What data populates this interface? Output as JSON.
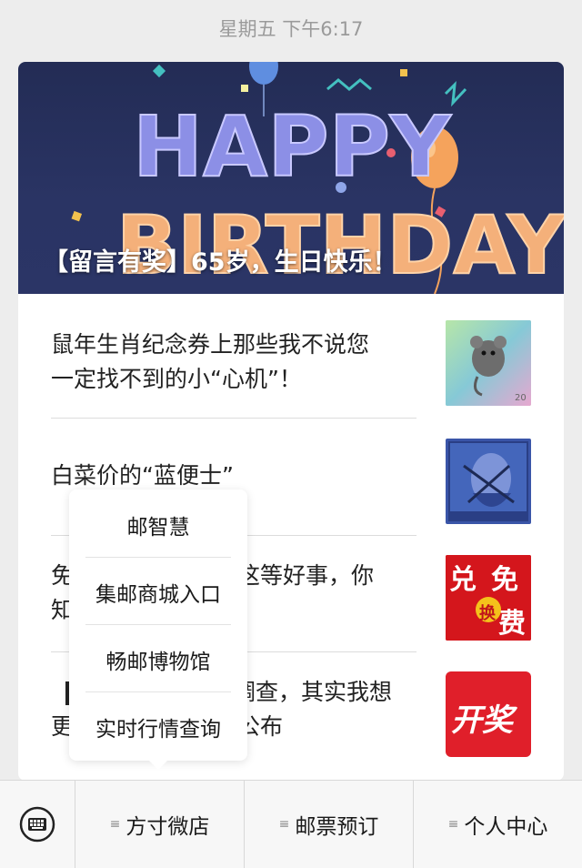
{
  "header": {
    "timestamp": "星期五 下午6:17"
  },
  "banner": {
    "image_text": "HAPPY BIRTHDAY",
    "caption": "【留言有奖】65岁，生日快乐！"
  },
  "articles": [
    {
      "title_line1": "鼠年生肖纪念券上那些我不说您",
      "title_line2": "一定找不到的小“心机”！",
      "thumb": "mouse-stamp-thumbnail"
    },
    {
      "title_line1": "白菜价的“蓝便士”",
      "title_line2": "",
      "thumb": "blue-penny-stamp-thumbnail"
    },
    {
      "title_line1": "免",
      "title_line1_tail": "这等好事，你",
      "title_line2": "知",
      "thumb": "free-exchange-thumbnail",
      "thumb_text": [
        "兑",
        "免",
        "换",
        "费"
      ]
    },
    {
      "title_line1": "",
      "title_line1_tail": "调查，其实我想",
      "title_line2": "更",
      "title_line2_tail": "公布",
      "thumb": "lottery-thumbnail",
      "thumb_text": "开奖"
    }
  ],
  "popup_menu": {
    "items": [
      "邮智慧",
      "集邮商城入口",
      "畅邮博物馆",
      "实时行情查询"
    ]
  },
  "bottom_menu": {
    "tabs": [
      {
        "label": "方寸微店",
        "icon": "list-icon"
      },
      {
        "label": "邮票预订",
        "icon": "list-icon"
      },
      {
        "label": "个人中心",
        "icon": "list-icon"
      }
    ],
    "keyboard_icon": "keyboard-icon"
  },
  "colors": {
    "banner_bg": "#232c55",
    "thumb_red": "#d4161c",
    "background": "#ededed"
  }
}
